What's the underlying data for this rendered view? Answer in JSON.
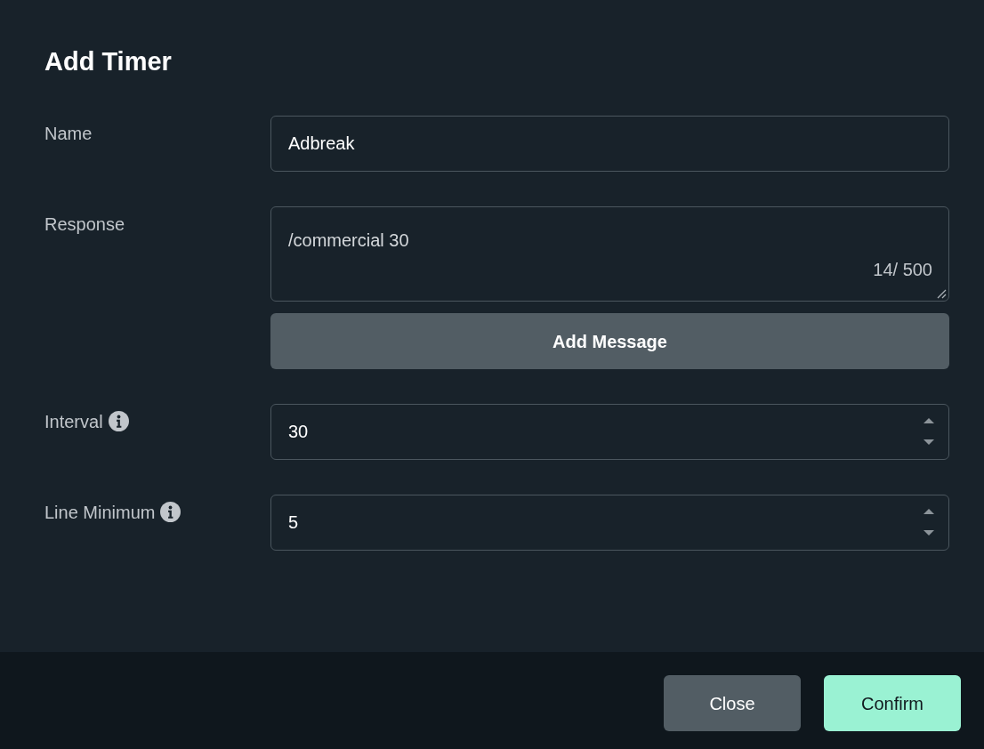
{
  "dialog": {
    "title": "Add Timer"
  },
  "fields": [
    {
      "kind": "text",
      "label": "Name",
      "info": false,
      "value": "Adbreak"
    },
    {
      "kind": "textarea",
      "label": "Response",
      "info": false,
      "value": "/commercial 30",
      "counter": "14/ 500",
      "action": "Add Message"
    },
    {
      "kind": "number",
      "label": "Interval",
      "info": true,
      "value": "30"
    },
    {
      "kind": "number",
      "label": "Line Minimum",
      "info": true,
      "value": "5"
    }
  ],
  "footer": {
    "buttons": [
      {
        "label": "Close",
        "kind": "secondary"
      },
      {
        "label": "Confirm",
        "kind": "primary"
      }
    ]
  }
}
